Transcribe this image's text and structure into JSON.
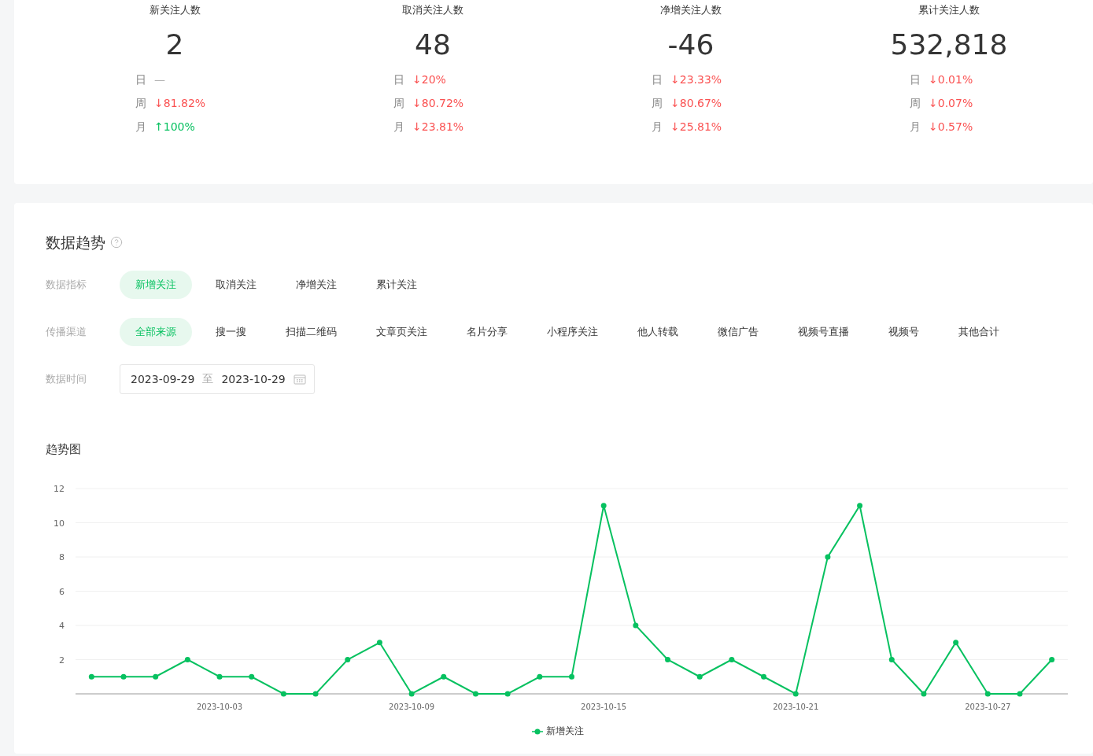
{
  "stats": [
    {
      "title": "新关注人数",
      "value": "2",
      "changes": [
        {
          "period": "日",
          "value": "—",
          "color": "#b2b2b2"
        },
        {
          "period": "周",
          "value": "↓81.82%",
          "color": "#fa5151"
        },
        {
          "period": "月",
          "value": "↑100%",
          "color": "#07c160"
        }
      ]
    },
    {
      "title": "取消关注人数",
      "value": "48",
      "changes": [
        {
          "period": "日",
          "value": "↓20%",
          "color": "#fa5151"
        },
        {
          "period": "周",
          "value": "↓80.72%",
          "color": "#fa5151"
        },
        {
          "period": "月",
          "value": "↓23.81%",
          "color": "#fa5151"
        }
      ]
    },
    {
      "title": "净增关注人数",
      "value": "-46",
      "changes": [
        {
          "period": "日",
          "value": "↓23.33%",
          "color": "#fa5151"
        },
        {
          "period": "周",
          "value": "↓80.67%",
          "color": "#fa5151"
        },
        {
          "period": "月",
          "value": "↓25.81%",
          "color": "#fa5151"
        }
      ]
    },
    {
      "title": "累计关注人数",
      "value": "532,818",
      "changes": [
        {
          "period": "日",
          "value": "↓0.01%",
          "color": "#fa5151"
        },
        {
          "period": "周",
          "value": "↓0.07%",
          "color": "#fa5151"
        },
        {
          "period": "月",
          "value": "↓0.57%",
          "color": "#fa5151"
        }
      ]
    }
  ],
  "trend": {
    "title": "数据趋势",
    "filters": [
      {
        "label": "数据指标",
        "options": [
          {
            "label": "新增关注",
            "selected": true
          },
          {
            "label": "取消关注",
            "selected": false
          },
          {
            "label": "净增关注",
            "selected": false
          },
          {
            "label": "累计关注",
            "selected": false
          }
        ]
      },
      {
        "label": "传播渠道",
        "options": [
          {
            "label": "全部来源",
            "selected": true
          },
          {
            "label": "搜一搜",
            "selected": false
          },
          {
            "label": "扫描二维码",
            "selected": false
          },
          {
            "label": "文章页关注",
            "selected": false
          },
          {
            "label": "名片分享",
            "selected": false
          },
          {
            "label": "小程序关注",
            "selected": false
          },
          {
            "label": "他人转载",
            "selected": false
          },
          {
            "label": "微信广告",
            "selected": false
          },
          {
            "label": "视频号直播",
            "selected": false
          },
          {
            "label": "视频号",
            "selected": false
          },
          {
            "label": "其他合计",
            "selected": false
          }
        ]
      }
    ],
    "date_range": {
      "label": "数据时间",
      "start": "2023-09-29",
      "separator": "至",
      "end": "2023-10-29"
    },
    "chart_title": "趋势图",
    "chart_data": {
      "type": "line",
      "x": [
        "2023-09-29",
        "2023-09-30",
        "2023-10-01",
        "2023-10-02",
        "2023-10-03",
        "2023-10-04",
        "2023-10-05",
        "2023-10-06",
        "2023-10-07",
        "2023-10-08",
        "2023-10-09",
        "2023-10-10",
        "2023-10-11",
        "2023-10-12",
        "2023-10-13",
        "2023-10-14",
        "2023-10-15",
        "2023-10-16",
        "2023-10-17",
        "2023-10-18",
        "2023-10-19",
        "2023-10-20",
        "2023-10-21",
        "2023-10-22",
        "2023-10-23",
        "2023-10-24",
        "2023-10-25",
        "2023-10-26",
        "2023-10-27",
        "2023-10-28",
        "2023-10-29"
      ],
      "series": [
        {
          "name": "新增关注",
          "color": "#07c160",
          "marker": true,
          "values": [
            1,
            1,
            1,
            2,
            1,
            1,
            0,
            0,
            2,
            3,
            0,
            1,
            0,
            0,
            1,
            1,
            11,
            4,
            2,
            1,
            2,
            1,
            0,
            8,
            11,
            2,
            0,
            3,
            0,
            0,
            2
          ]
        }
      ],
      "xlim": [
        "2023-09-28 12:00",
        "2023-10-29 12:00"
      ],
      "grid": true,
      "ylim": [
        0,
        12
      ],
      "yticks": [
        2,
        4,
        6,
        8,
        10,
        12
      ],
      "xticks": [
        "2023-10-03",
        "2023-10-09",
        "2023-10-15",
        "2023-10-21",
        "2023-10-27"
      ]
    }
  }
}
